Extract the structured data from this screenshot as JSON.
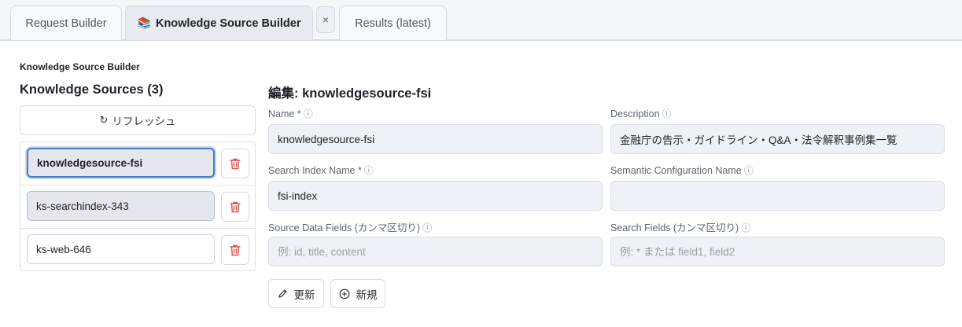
{
  "tabs": [
    {
      "label": "Request Builder",
      "icon": ""
    },
    {
      "label": "Knowledge Source Builder",
      "icon": "📚"
    },
    {
      "label": "Results (latest)",
      "icon": ""
    }
  ],
  "tab_close": "×",
  "page_title": "Knowledge Source Builder",
  "list": {
    "heading": "Knowledge Sources (3)",
    "refresh_label": "リフレッシュ",
    "items": [
      {
        "name": "knowledgesource-fsi",
        "state": "selected"
      },
      {
        "name": "ks-searchindex-343",
        "state": "hover"
      },
      {
        "name": "ks-web-646",
        "state": "normal"
      }
    ]
  },
  "editor": {
    "heading": "編集: knowledgesource-fsi",
    "info_glyph": "ⓘ",
    "fields": {
      "name": {
        "label": "Name *",
        "value": "knowledgesource-fsi",
        "placeholder": ""
      },
      "description": {
        "label": "Description",
        "value": "金融庁の告示・ガイドライン・Q&A・法令解釈事例集一覧",
        "placeholder": ""
      },
      "search_index": {
        "label": "Search Index Name *",
        "value": "fsi-index",
        "placeholder": ""
      },
      "semantic_config": {
        "label": "Semantic Configuration Name",
        "value": "",
        "placeholder": ""
      },
      "source_fields": {
        "label": "Source Data Fields (カンマ区切り)",
        "value": "",
        "placeholder": "例: id, title, content"
      },
      "search_fields": {
        "label": "Search Fields (カンマ区切り)",
        "value": "",
        "placeholder": "例: * または field1, field2"
      }
    },
    "update_label": "更新",
    "new_label": "新規"
  },
  "colors": {
    "accent": "#4a7cc2",
    "delete": "#d9534f"
  }
}
